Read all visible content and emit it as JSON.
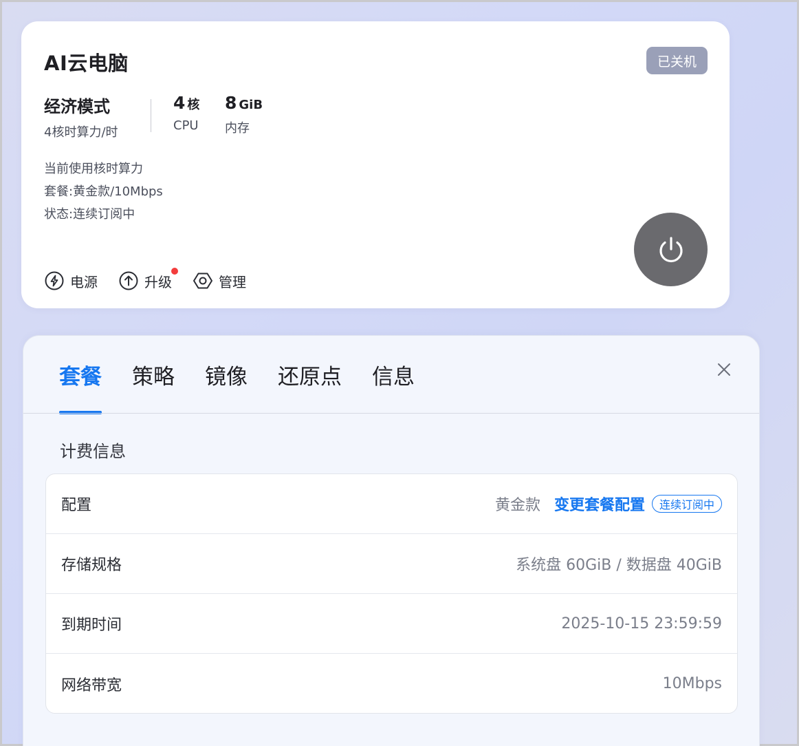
{
  "card": {
    "title": "AI云电脑",
    "status": "已关机",
    "mode_name": "经济模式",
    "mode_desc": "4核时算力/时",
    "cpu_value": "4",
    "cpu_unit": "核",
    "cpu_label": "CPU",
    "mem_value": "8",
    "mem_unit": "GiB",
    "mem_label": "内存",
    "info": [
      "当前使用核时算力",
      "套餐:黄金款/10Mbps",
      "状态:连续订阅中"
    ],
    "actions": {
      "power": "电源",
      "upgrade": "升级",
      "manage": "管理"
    },
    "upgrade_has_notification": true,
    "power_button_color": "#6a6a6e"
  },
  "panel": {
    "tabs": [
      {
        "label": "套餐",
        "active": true
      },
      {
        "label": "策略",
        "active": false
      },
      {
        "label": "镜像",
        "active": false
      },
      {
        "label": "还原点",
        "active": false
      },
      {
        "label": "信息",
        "active": false
      }
    ],
    "section_title": "计费信息",
    "rows": {
      "config": {
        "label": "配置",
        "value": "黄金款",
        "link": "变更套餐配置",
        "tag": "连续订阅中"
      },
      "storage": {
        "label": "存储规格",
        "value": "系统盘 60GiB / 数据盘 40GiB"
      },
      "expiry": {
        "label": "到期时间",
        "value": "2025-10-15 23:59:59"
      },
      "bandwidth": {
        "label": "网络带宽",
        "value": "10Mbps"
      }
    }
  },
  "colors": {
    "accent": "#1677f0",
    "status_badge": "#9aa0b8",
    "notification_dot": "#f33d3d"
  },
  "icons": [
    "lightning-icon",
    "arrow-up-circle-icon",
    "hexagon-settings-icon",
    "power-icon",
    "close-icon"
  ]
}
